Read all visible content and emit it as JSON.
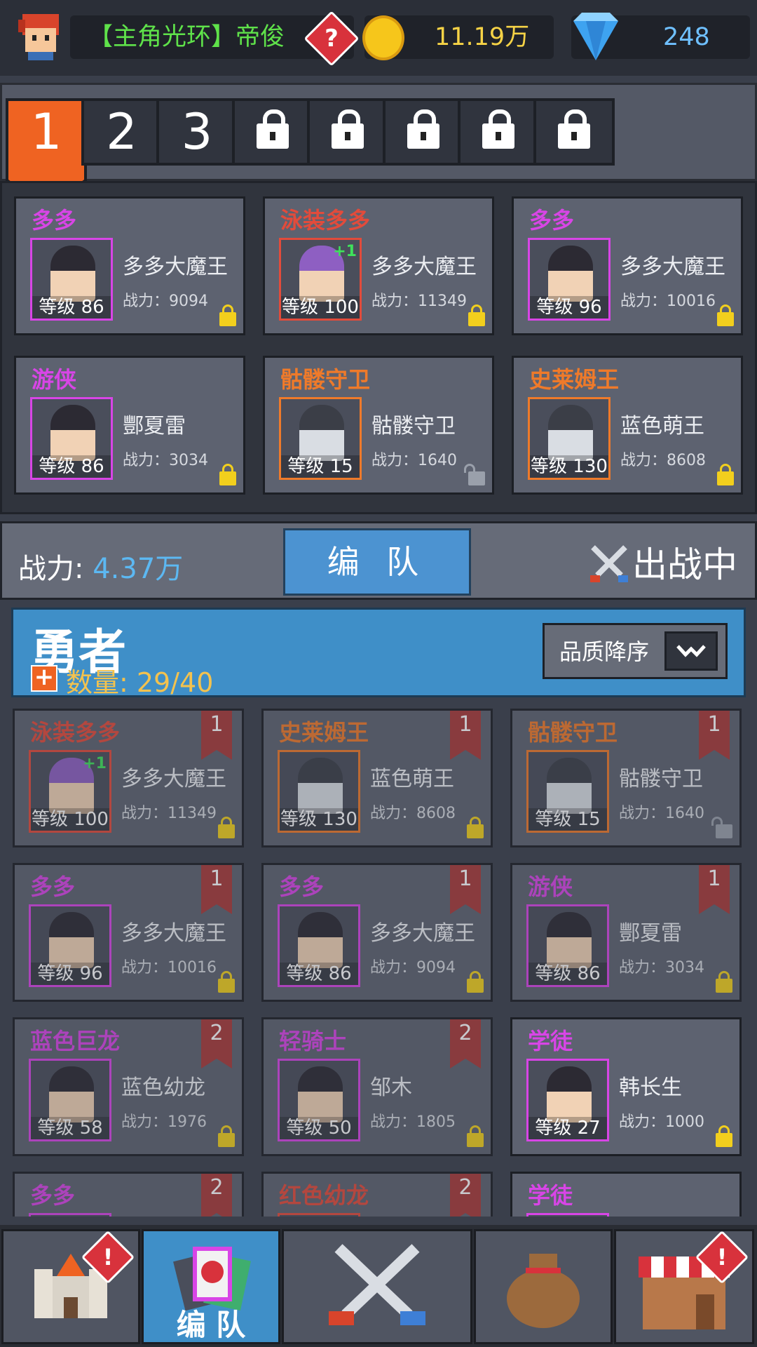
{
  "header": {
    "player_name": "【主角光环】帝俊",
    "help_glyph": "?",
    "gold": "11.19万",
    "gems": "248"
  },
  "team_tabs": [
    {
      "label": "1",
      "state": "active"
    },
    {
      "label": "2",
      "state": "normal"
    },
    {
      "label": "3",
      "state": "normal"
    },
    {
      "label": "",
      "state": "locked"
    },
    {
      "label": "",
      "state": "locked"
    },
    {
      "label": "",
      "state": "locked"
    },
    {
      "label": "",
      "state": "locked"
    },
    {
      "label": "",
      "state": "locked"
    }
  ],
  "team": [
    {
      "title": "多多",
      "title_color": "#d845e6",
      "name": "多多大魔王",
      "power": "战力：9094",
      "level": "等级 86",
      "frame": "purple",
      "plus": "",
      "lock": "locked"
    },
    {
      "title": "泳装多多",
      "title_color": "#e24b3b",
      "name": "多多大魔王",
      "power": "战力：11349",
      "level": "等级 100",
      "frame": "red",
      "plus": "+1",
      "lock": "locked"
    },
    {
      "title": "多多",
      "title_color": "#d845e6",
      "name": "多多大魔王",
      "power": "战力：10016",
      "level": "等级 96",
      "frame": "purple",
      "plus": "",
      "lock": "locked"
    },
    {
      "title": "游侠",
      "title_color": "#d845e6",
      "name": "酆夏雷",
      "power": "战力：3034",
      "level": "等级 86",
      "frame": "purple",
      "plus": "",
      "lock": "locked"
    },
    {
      "title": "骷髅守卫",
      "title_color": "#ef7a2a",
      "name": "骷髅守卫",
      "power": "战力：1640",
      "level": "等级 15",
      "frame": "orange",
      "plus": "",
      "lock": "open"
    },
    {
      "title": "史莱姆王",
      "title_color": "#ef7a2a",
      "name": "蓝色萌王",
      "power": "战力：8608",
      "level": "等级 130",
      "frame": "orange",
      "plus": "",
      "lock": "locked"
    }
  ],
  "power_bar": {
    "label": "战力:",
    "value": "4.37万",
    "form_button": "编 队",
    "status": "出战中"
  },
  "heroes": {
    "title": "勇者",
    "add_glyph": "+",
    "count_label": "数量: 29/40",
    "sort_label": "品质降序"
  },
  "hero_list": [
    {
      "title": "泳装多多",
      "title_color": "#e24b3b",
      "name": "多多大魔王",
      "power": "战力：11349",
      "level": "等级 100",
      "frame": "red",
      "plus": "+1",
      "ribbon": "1",
      "lock": "locked",
      "dim": true
    },
    {
      "title": "史莱姆王",
      "title_color": "#ef7a2a",
      "name": "蓝色萌王",
      "power": "战力：8608",
      "level": "等级 130",
      "frame": "orange",
      "plus": "",
      "ribbon": "1",
      "lock": "locked",
      "dim": true
    },
    {
      "title": "骷髅守卫",
      "title_color": "#ef7a2a",
      "name": "骷髅守卫",
      "power": "战力：1640",
      "level": "等级 15",
      "frame": "orange",
      "plus": "",
      "ribbon": "1",
      "lock": "open",
      "dim": true
    },
    {
      "title": "多多",
      "title_color": "#d845e6",
      "name": "多多大魔王",
      "power": "战力：10016",
      "level": "等级 96",
      "frame": "purple",
      "plus": "",
      "ribbon": "1",
      "lock": "locked",
      "dim": true
    },
    {
      "title": "多多",
      "title_color": "#d845e6",
      "name": "多多大魔王",
      "power": "战力：9094",
      "level": "等级 86",
      "frame": "purple",
      "plus": "",
      "ribbon": "1",
      "lock": "locked",
      "dim": true
    },
    {
      "title": "游侠",
      "title_color": "#d845e6",
      "name": "酆夏雷",
      "power": "战力：3034",
      "level": "等级 86",
      "frame": "purple",
      "plus": "",
      "ribbon": "1",
      "lock": "locked",
      "dim": true
    },
    {
      "title": "蓝色巨龙",
      "title_color": "#d845e6",
      "name": "蓝色幼龙",
      "power": "战力：1976",
      "level": "等级 58",
      "frame": "purple",
      "plus": "",
      "ribbon": "2",
      "lock": "locked",
      "dim": true
    },
    {
      "title": "轻骑士",
      "title_color": "#d845e6",
      "name": "邹木",
      "power": "战力：1805",
      "level": "等级 50",
      "frame": "purple",
      "plus": "",
      "ribbon": "2",
      "lock": "locked",
      "dim": true
    },
    {
      "title": "学徒",
      "title_color": "#d845e6",
      "name": "韩长生",
      "power": "战力：1000",
      "level": "等级 27",
      "frame": "purple",
      "plus": "",
      "ribbon": "",
      "lock": "locked",
      "dim": false
    },
    {
      "title": "多多",
      "title_color": "#d845e6",
      "name": "",
      "power": "",
      "level": "",
      "frame": "purple",
      "plus": "",
      "ribbon": "2",
      "lock": "",
      "dim": true
    },
    {
      "title": "红色幼龙",
      "title_color": "#e24b3b",
      "name": "",
      "power": "",
      "level": "",
      "frame": "red",
      "plus": "",
      "ribbon": "2",
      "lock": "",
      "dim": true
    },
    {
      "title": "学徒",
      "title_color": "#d845e6",
      "name": "",
      "power": "",
      "level": "",
      "frame": "purple",
      "plus": "",
      "ribbon": "",
      "lock": "",
      "dim": false
    }
  ],
  "bottom_nav": [
    {
      "icon": "castle-icon",
      "label": "",
      "badge": "!",
      "active": false
    },
    {
      "icon": "team-cards-icon",
      "label": "编 队",
      "badge": "",
      "active": true
    },
    {
      "icon": "crossed-swords-icon",
      "label": "",
      "badge": "",
      "active": false
    },
    {
      "icon": "loot-bag-icon",
      "label": "",
      "badge": "",
      "active": false
    },
    {
      "icon": "shop-icon",
      "label": "",
      "badge": "!",
      "active": false
    }
  ]
}
